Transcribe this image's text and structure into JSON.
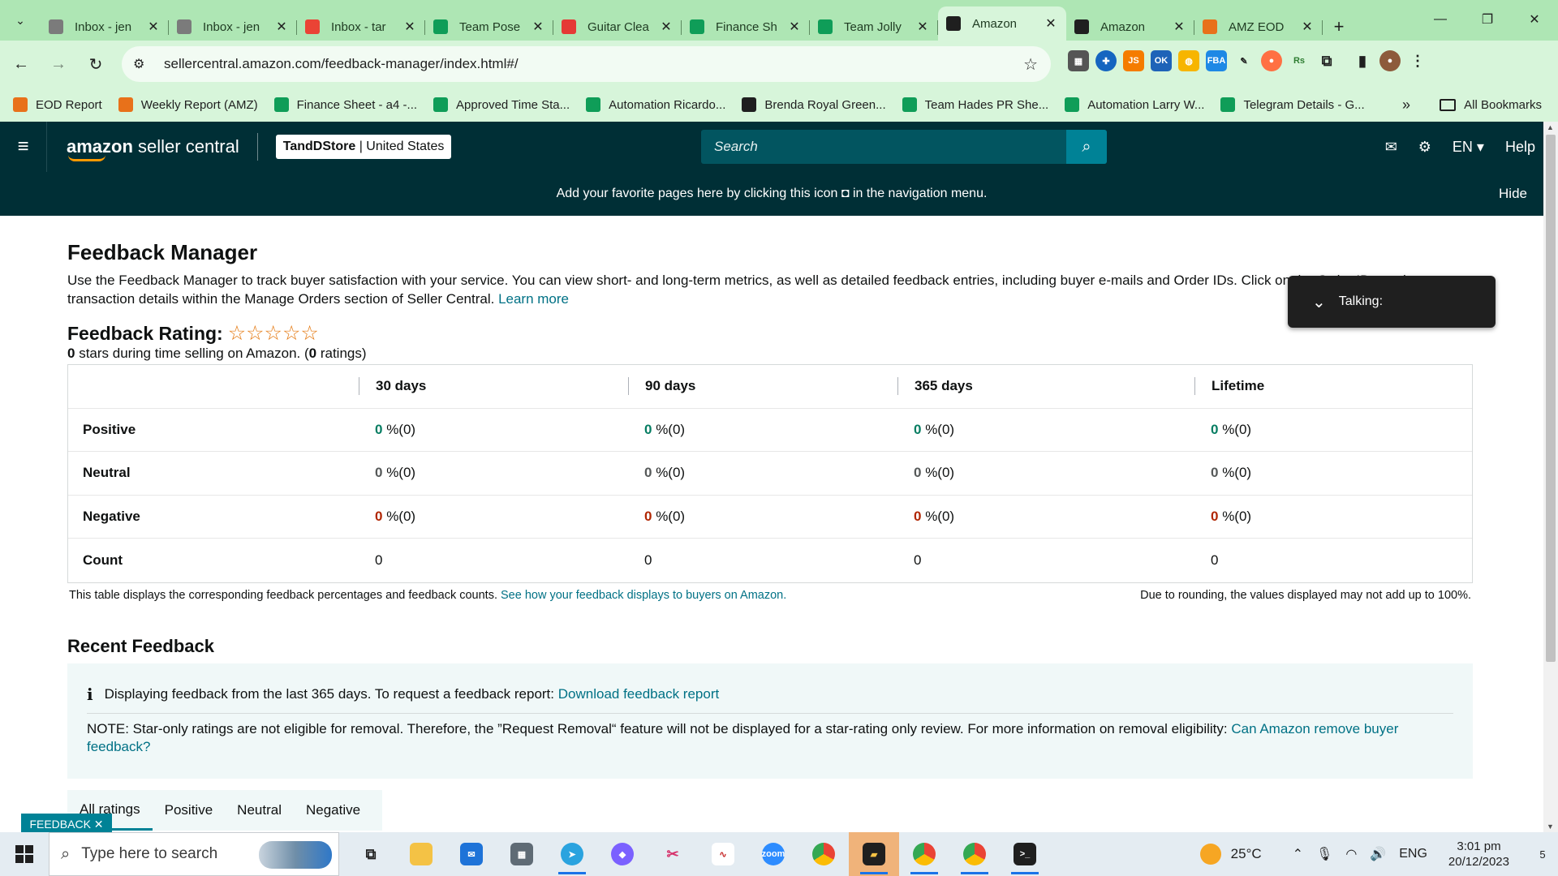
{
  "browser": {
    "tabs": [
      {
        "title": "Inbox - jen",
        "icon": "mail-icon",
        "color": "#7b7b7b"
      },
      {
        "title": "Inbox - jen",
        "icon": "mail-icon",
        "color": "#7b7b7b"
      },
      {
        "title": "Inbox - tar",
        "icon": "gmail-icon",
        "color": "#ea4335"
      },
      {
        "title": "Team Pose",
        "icon": "sheets-icon",
        "color": "#0f9d58"
      },
      {
        "title": "Guitar Clea",
        "icon": "s-icon",
        "color": "#e53935"
      },
      {
        "title": "Finance Sh",
        "icon": "sheets-icon",
        "color": "#0f9d58"
      },
      {
        "title": "Team Jolly",
        "icon": "sheets-icon",
        "color": "#0f9d58"
      },
      {
        "title": "Amazon",
        "icon": "amazon-icon",
        "color": "#1f1f1f",
        "active": true
      },
      {
        "title": "Amazon",
        "icon": "amazon-icon",
        "color": "#1f1f1f"
      },
      {
        "title": "AMZ EOD",
        "icon": "pencil-icon",
        "color": "#e8711a"
      }
    ],
    "url": "sellercentral.amazon.com/feedback-manager/index.html#/",
    "bookmarks": [
      {
        "label": "EOD Report",
        "color": "#e8711a"
      },
      {
        "label": "Weekly Report (AMZ)",
        "color": "#e8711a"
      },
      {
        "label": "Finance Sheet - a4 -...",
        "color": "#0f9d58"
      },
      {
        "label": "Approved Time Sta...",
        "color": "#0f9d58"
      },
      {
        "label": "Automation Ricardo...",
        "color": "#0f9d58"
      },
      {
        "label": "Brenda Royal Green...",
        "color": "#1f1f1f"
      },
      {
        "label": "Team Hades PR She...",
        "color": "#0f9d58"
      },
      {
        "label": "Automation Larry W...",
        "color": "#0f9d58"
      },
      {
        "label": "Telegram Details - G...",
        "color": "#0f9d58"
      }
    ],
    "bookmarks_more": "»",
    "all_bookmarks": "All Bookmarks"
  },
  "header": {
    "logo_bold": "amazon",
    "logo_rest": " seller central",
    "store_name": "TandDStore",
    "store_region": " | United States",
    "search_placeholder": "Search",
    "lang": "EN ▾",
    "help": "Help"
  },
  "banner": {
    "text": "Add your favorite pages here by clicking this icon ◘ in the navigation menu.",
    "hide": "Hide"
  },
  "page": {
    "title": "Feedback Manager",
    "intro": "Use the Feedback Manager to track buyer satisfaction with your service. You can view short- and long-term metrics, as well as detailed feedback entries, including buyer e-mails and Order IDs. Click on the Order IDs to view transaction details within the Manage Orders section of Seller Central.",
    "learn_more": "Learn more",
    "rating_label": "Feedback Rating:",
    "stars": "☆☆☆☆☆",
    "rating_stars_count": "0",
    "rating_mid": " stars during time selling on Amazon. (",
    "rating_count": "0",
    "rating_end": " ratings)"
  },
  "feedback_table": {
    "columns": [
      "",
      "30 days",
      "90 days",
      "365 days",
      "Lifetime"
    ],
    "rows": [
      {
        "label": "Positive",
        "values": [
          "0",
          "0",
          "0",
          "0"
        ],
        "suffix": " %(0)"
      },
      {
        "label": "Neutral",
        "values": [
          "0",
          "0",
          "0",
          "0"
        ],
        "suffix": " %(0)"
      },
      {
        "label": "Negative",
        "values": [
          "0",
          "0",
          "0",
          "0"
        ],
        "suffix": " %(0)"
      },
      {
        "label": "Count",
        "values": [
          "0",
          "0",
          "0",
          "0"
        ]
      }
    ],
    "note_left": "This table displays the corresponding feedback percentages and feedback counts.",
    "note_link": "See how your feedback displays to buyers on Amazon.",
    "note_right": "Due to rounding, the values displayed may not add up to 100%."
  },
  "recent": {
    "title": "Recent Feedback",
    "info_text": "Displaying feedback from the last 365 days. To request a feedback report:",
    "info_link": "Download feedback report",
    "note_text": "NOTE: Star-only ratings are not eligible for removal. Therefore, the ”Request Removal“ feature will not be displayed for a star-rating only review. For more information on removal eligibility:",
    "note_link": "Can Amazon remove buyer feedback?",
    "tabs": [
      "All ratings",
      "Positive",
      "Neutral",
      "Negative"
    ]
  },
  "feedback_button": "FEEDBACK ✕",
  "toast": {
    "text": "Talking:"
  },
  "taskbar": {
    "search_placeholder": "Type here to search",
    "weather": "25°C",
    "lang": "ENG",
    "time": "3:01 pm",
    "date": "20/12/2023",
    "notif_count": "5"
  }
}
